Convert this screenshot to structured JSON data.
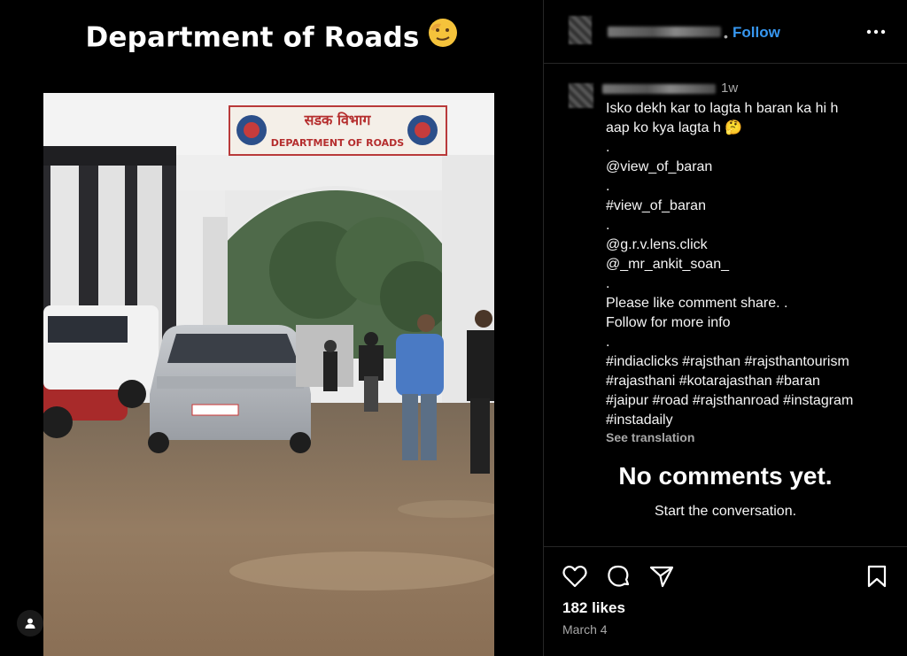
{
  "post": {
    "overlay_title": "Department of Roads",
    "photo": {
      "sign_top": "सडक विभाग",
      "sign_bottom": "DEPARTMENT OF ROADS"
    }
  },
  "header": {
    "follow_label": "Follow",
    "separator": "•",
    "more_icon": "more-horizontal-icon"
  },
  "caption": {
    "time": "1w",
    "lines": [
      "Isko dekh kar to lagta h baran ka hi h",
      "aap ko kya lagta h 🤔",
      ".",
      "@view_of_baran",
      ".",
      "#view_of_baran",
      ".",
      "@g.r.v.lens.click",
      "@_mr_ankit_soan_",
      ".",
      "Please like comment share. .",
      "Follow for more info",
      ".",
      "#indiaclicks #rajsthan #rajsthantourism",
      "#rajasthani #kotarajasthan #baran",
      "#jaipur #road #rajsthanroad #instagram",
      "#instadaily"
    ],
    "see_translation": "See translation"
  },
  "comments": {
    "empty_title": "No comments yet.",
    "empty_subtitle": "Start the conversation."
  },
  "actions": {
    "icons": [
      "heart-icon",
      "comment-icon",
      "share-icon",
      "bookmark-icon"
    ],
    "likes": "182 likes",
    "date": "March 4"
  }
}
